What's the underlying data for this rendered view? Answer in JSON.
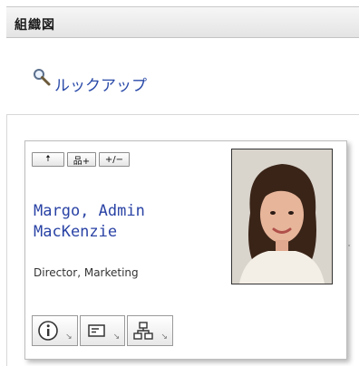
{
  "header": {
    "title": "組織図"
  },
  "lookup": {
    "label": "ルックアップ",
    "icon": "magnifier-icon"
  },
  "card": {
    "toolbar": {
      "up_label": "🠅",
      "org_label": "品+",
      "expand_label": "+/−"
    },
    "name_line1": "Margo, Admin",
    "name_line2": "MacKenzie",
    "title": "Director, Marketing",
    "actions": [
      {
        "icon": "info-icon"
      },
      {
        "icon": "email-icon"
      },
      {
        "icon": "org-chart-icon"
      }
    ]
  },
  "colors": {
    "link": "#2a43a5",
    "header_bg": "#eeeeee"
  }
}
